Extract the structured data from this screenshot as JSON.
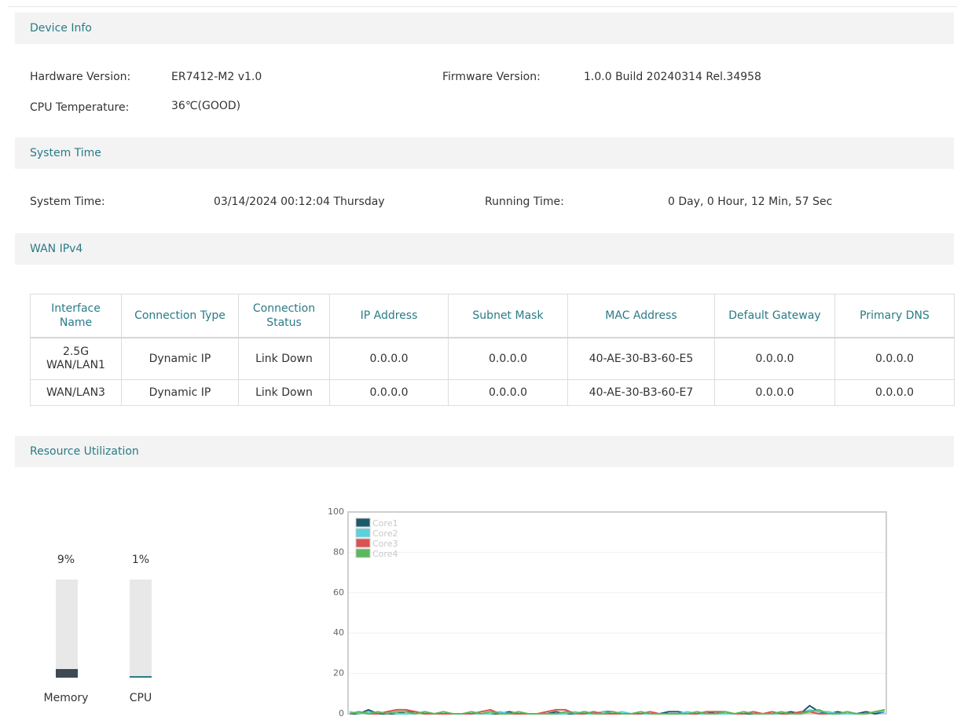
{
  "device_info": {
    "header": "Device Info",
    "hardware_label": "Hardware Version:",
    "hardware_value": "ER7412-M2 v1.0",
    "firmware_label": "Firmware Version:",
    "firmware_value": "1.0.0 Build 20240314 Rel.34958",
    "cpu_temp_label": "CPU Temperature:",
    "cpu_temp_value": "36℃(GOOD)"
  },
  "system_time": {
    "header": "System Time",
    "time_label": "System Time:",
    "time_value": "03/14/2024 00:12:04 Thursday",
    "running_label": "Running Time:",
    "running_value": "0 Day, 0 Hour, 12 Min, 57 Sec"
  },
  "wan_ipv4": {
    "header": "WAN IPv4",
    "columns": [
      "Interface Name",
      "Connection Type",
      "Connection Status",
      "IP Address",
      "Subnet Mask",
      "MAC Address",
      "Default Gateway",
      "Primary DNS"
    ],
    "rows": [
      [
        "2.5G WAN/LAN1",
        "Dynamic IP",
        "Link Down",
        "0.0.0.0",
        "0.0.0.0",
        "40-AE-30-B3-60-E5",
        "0.0.0.0",
        "0.0.0.0"
      ],
      [
        "WAN/LAN3",
        "Dynamic IP",
        "Link Down",
        "0.0.0.0",
        "0.0.0.0",
        "40-AE-30-B3-60-E7",
        "0.0.0.0",
        "0.0.0.0"
      ]
    ]
  },
  "resource": {
    "header": "Resource Utilization",
    "memory_label": "Memory",
    "memory_percent_text": "9%",
    "memory_value": 9,
    "memory_color": "#3d4a54",
    "cpu_label": "CPU",
    "cpu_percent_text": "1%",
    "cpu_value": 1,
    "cpu_color": "#2a7b86"
  },
  "chart_data": {
    "type": "line",
    "ylim": [
      0,
      100
    ],
    "yticks": [
      0,
      20,
      40,
      60,
      80,
      100
    ],
    "grid": true,
    "legend_position": "top-left",
    "series": [
      {
        "name": "Core1",
        "color": "#1a5a6b",
        "values": [
          0,
          0,
          2,
          0,
          0,
          0,
          1,
          1,
          0,
          0,
          0,
          0,
          0,
          0,
          0,
          0,
          0,
          1,
          0,
          0,
          0,
          0,
          1,
          0,
          0,
          1,
          0,
          1,
          1,
          0,
          0,
          0,
          0,
          0,
          1,
          1,
          0,
          0,
          0,
          1,
          0,
          0,
          0,
          0,
          0,
          0,
          0,
          1,
          0,
          4,
          1,
          0,
          1,
          0,
          0,
          1,
          0,
          1
        ]
      },
      {
        "name": "Core2",
        "color": "#5ad1dc",
        "values": [
          1,
          0,
          1,
          0,
          1,
          0,
          0,
          0,
          1,
          0,
          0,
          0,
          0,
          0,
          0,
          0,
          1,
          0,
          0,
          0,
          0,
          0,
          0,
          0,
          1,
          0,
          0,
          1,
          0,
          1,
          0,
          0,
          0,
          0,
          0,
          0,
          1,
          0,
          0,
          0,
          0,
          0,
          0,
          1,
          0,
          0,
          0,
          0,
          0,
          2,
          1,
          1,
          0,
          0,
          0,
          0,
          1,
          1
        ]
      },
      {
        "name": "Core3",
        "color": "#d9534f",
        "values": [
          0,
          1,
          0,
          0,
          1,
          2,
          2,
          1,
          0,
          0,
          0,
          0,
          0,
          0,
          1,
          2,
          0,
          0,
          0,
          0,
          0,
          1,
          2,
          2,
          0,
          0,
          1,
          0,
          0,
          0,
          0,
          0,
          1,
          0,
          0,
          0,
          0,
          0,
          1,
          1,
          1,
          0,
          0,
          1,
          0,
          1,
          0,
          0,
          1,
          1,
          0,
          0,
          0,
          1,
          0,
          0,
          1,
          2
        ]
      },
      {
        "name": "Core4",
        "color": "#5cb85c",
        "values": [
          0,
          1,
          0,
          1,
          0,
          1,
          1,
          0,
          1,
          0,
          1,
          0,
          0,
          1,
          0,
          1,
          0,
          0,
          1,
          0,
          0,
          0,
          0,
          1,
          0,
          1,
          0,
          0,
          1,
          0,
          0,
          1,
          0,
          0,
          0,
          0,
          0,
          1,
          0,
          0,
          1,
          0,
          1,
          0,
          0,
          0,
          1,
          0,
          0,
          1,
          2,
          0,
          0,
          1,
          0,
          0,
          1,
          2
        ]
      }
    ]
  }
}
